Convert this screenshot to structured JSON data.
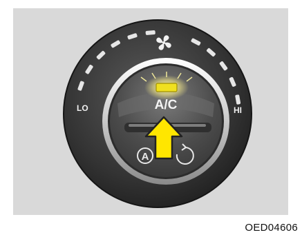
{
  "figure": {
    "code": "OED04606"
  },
  "control": {
    "lo_label": "LO",
    "hi_label": "HI",
    "button_label": "A/C",
    "indicator_state": "on",
    "fan_icon": "fan-icon",
    "auto_icon": "auto-a-icon",
    "recirculation_icon": "recirculation-icon",
    "arrow_icon": "press-arrow-icon"
  },
  "colors": {
    "panel": "#d9d9d9",
    "knob_outer": "#3a3a3a",
    "knob_inner": "#565656",
    "indicator_on": "#f0e020",
    "arrow_fill": "#ffe600",
    "arrow_stroke": "#222222",
    "tick": "#e6e6e6"
  }
}
